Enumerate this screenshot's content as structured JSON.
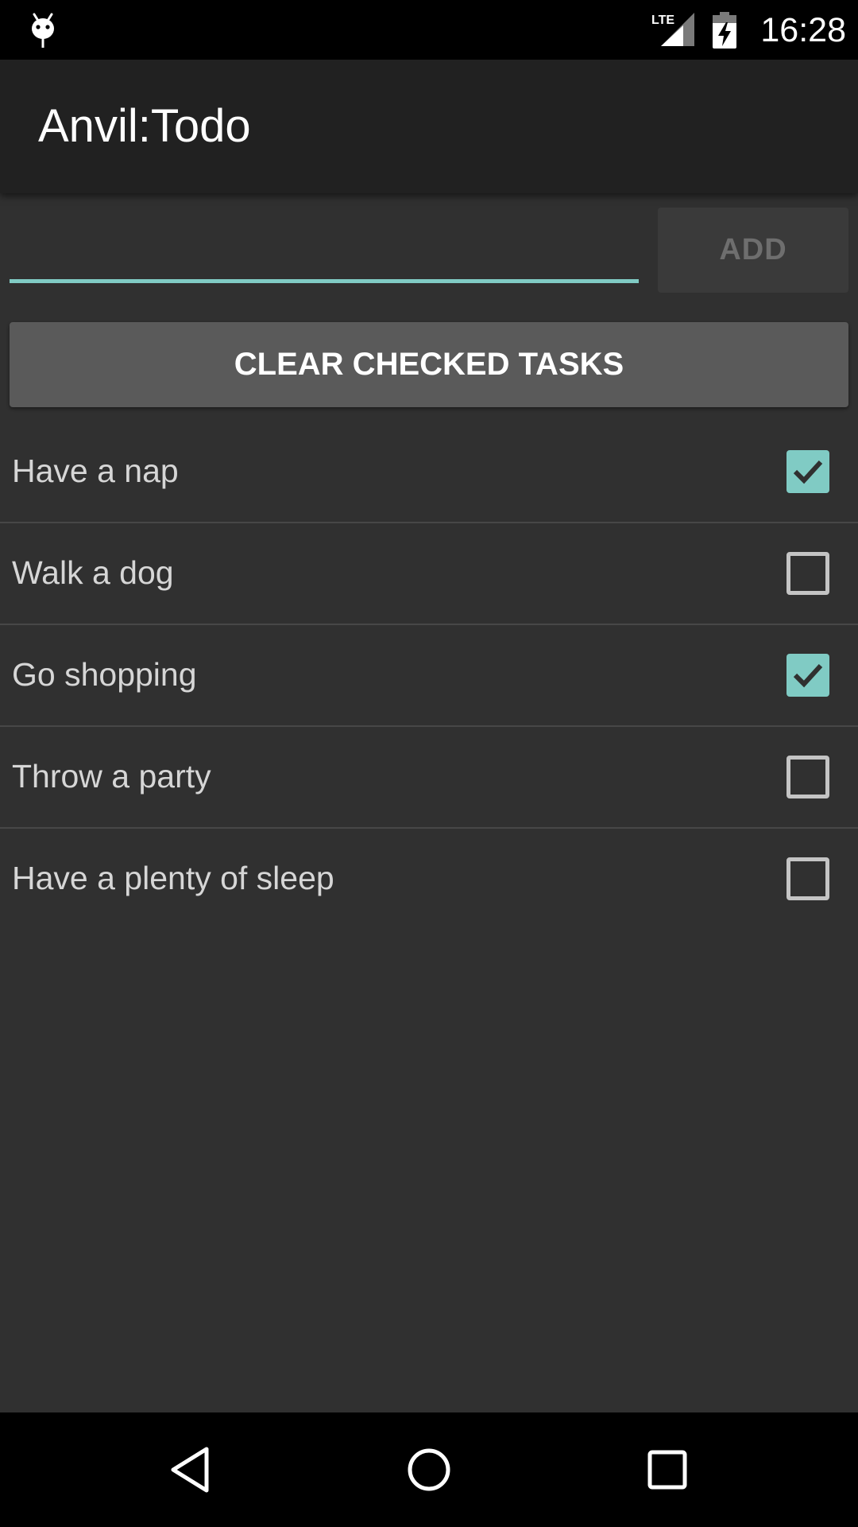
{
  "status_bar": {
    "time": "16:28",
    "network_label": "LTE",
    "icons": [
      "debug-icon",
      "lte-signal-icon",
      "battery-charging-icon"
    ]
  },
  "toolbar": {
    "title": "Anvil:Todo"
  },
  "input": {
    "value": "",
    "placeholder": ""
  },
  "buttons": {
    "add_label": "ADD",
    "clear_label": "CLEAR CHECKED TASKS"
  },
  "tasks": [
    {
      "label": "Have a nap",
      "checked": true
    },
    {
      "label": "Walk a dog",
      "checked": false
    },
    {
      "label": "Go shopping",
      "checked": true
    },
    {
      "label": "Throw a party",
      "checked": false
    },
    {
      "label": "Have a plenty of sleep",
      "checked": false
    }
  ],
  "nav_bar": {
    "icons": [
      "back-icon",
      "home-icon",
      "recents-icon"
    ]
  },
  "colors": {
    "background": "#303030",
    "toolbar": "#212121",
    "accent": "#80cbc4",
    "clear_button": "#5a5a5a"
  }
}
